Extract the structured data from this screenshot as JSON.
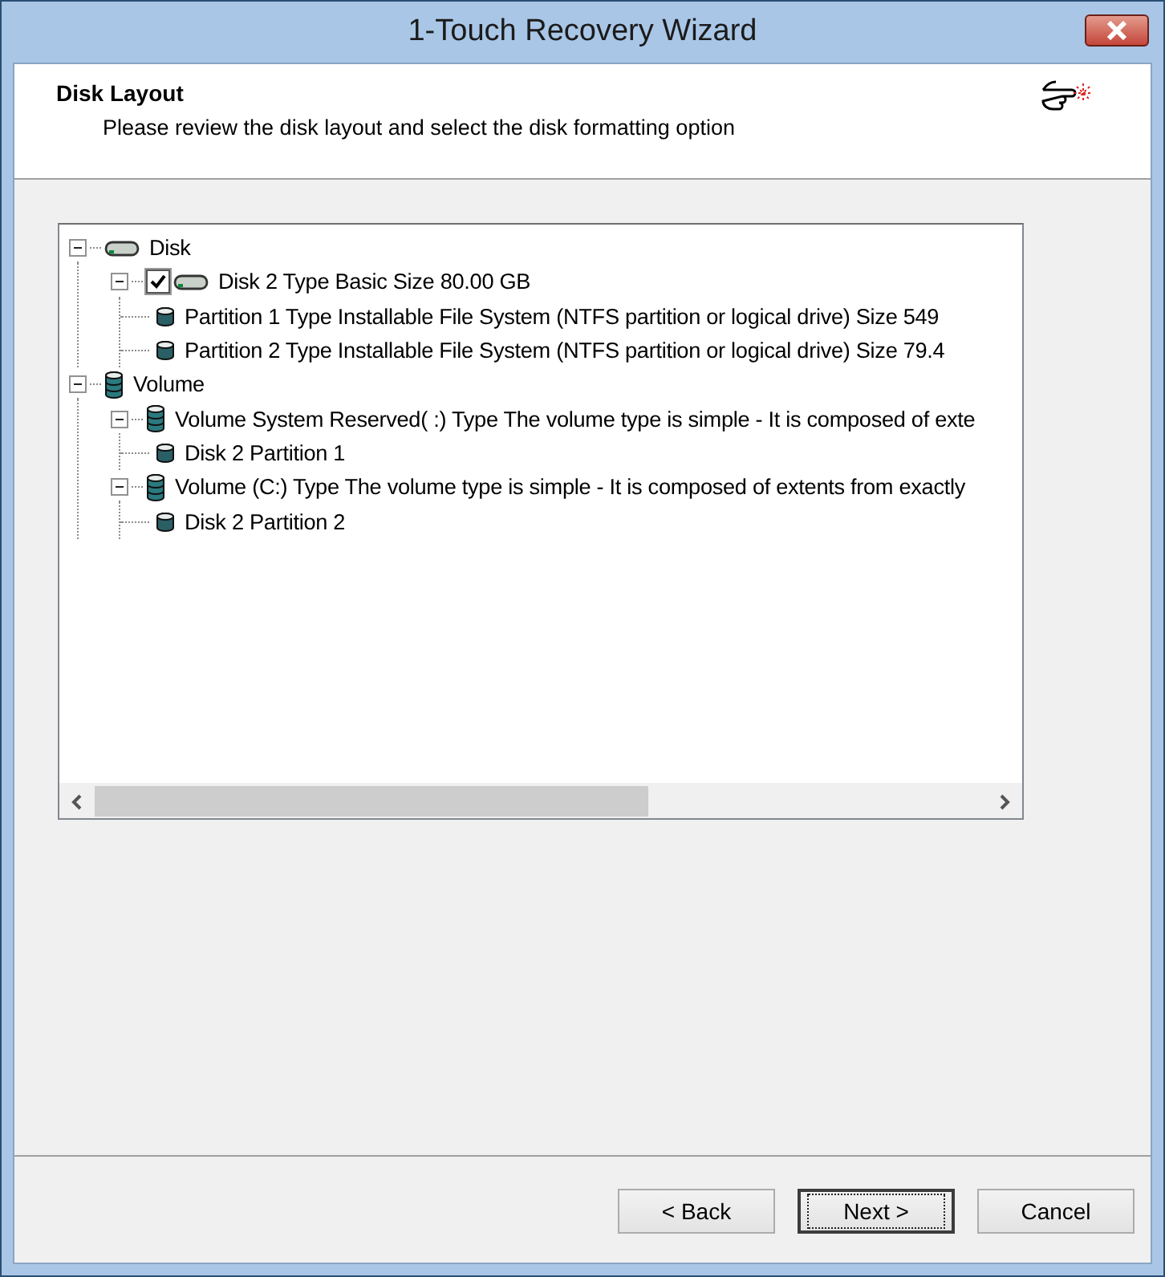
{
  "window": {
    "title": "1-Touch Recovery Wizard"
  },
  "header": {
    "title": "Disk Layout",
    "subtitle": "Please review the disk layout and select the disk formatting option"
  },
  "tree": [
    {
      "kind": "disk",
      "label": "Disk",
      "expanded": true,
      "children": [
        {
          "kind": "disk",
          "label": "Disk 2 Type Basic Size 80.00 GB",
          "checked": true,
          "expanded": true,
          "children": [
            {
              "kind": "partition",
              "label": "Partition 1 Type Installable File System (NTFS partition or logical drive) Size 549"
            },
            {
              "kind": "partition",
              "label": "Partition 2 Type Installable File System (NTFS partition or logical drive) Size 79.4"
            }
          ]
        }
      ]
    },
    {
      "kind": "volume",
      "label": "Volume",
      "expanded": true,
      "children": [
        {
          "kind": "volume",
          "label": "Volume System Reserved( :) Type The volume type is simple - It is composed of exte",
          "expanded": true,
          "children": [
            {
              "kind": "partition",
              "label": "Disk 2 Partition 1"
            }
          ]
        },
        {
          "kind": "volume",
          "label": "Volume (C:) Type The volume type is simple - It is composed of extents from exactly",
          "expanded": true,
          "children": [
            {
              "kind": "partition",
              "label": "Disk 2 Partition 2"
            }
          ]
        }
      ]
    }
  ],
  "buttons": [
    {
      "label": "< Back",
      "default": false
    },
    {
      "label": "Next >",
      "default": true
    },
    {
      "label": "Cancel",
      "default": false
    }
  ]
}
